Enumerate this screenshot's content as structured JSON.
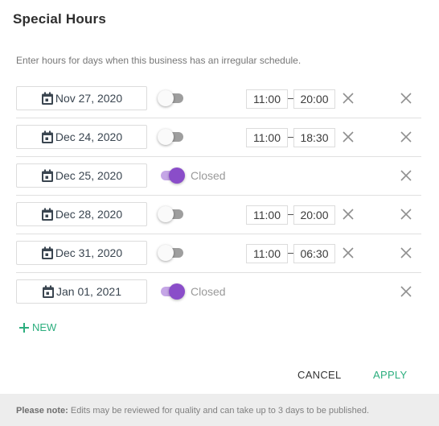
{
  "dialog": {
    "title": "Special Hours",
    "subtitle": "Enter hours for days when this business has an irregular schedule."
  },
  "colors": {
    "accent_green": "#2cae7e",
    "toggle_on_knob": "#8a4dc9",
    "toggle_on_track": "#c5a6e6",
    "toggle_off_track": "#9e9e9e"
  },
  "rows": [
    {
      "date": "Nov 27, 2020",
      "closed": false,
      "open": "11:00",
      "close": "20:00"
    },
    {
      "date": "Dec 24, 2020",
      "closed": false,
      "open": "11:00",
      "close": "18:30"
    },
    {
      "date": "Dec 25, 2020",
      "closed": true,
      "closed_label": "Closed"
    },
    {
      "date": "Dec 28, 2020",
      "closed": false,
      "open": "11:00",
      "close": "20:00"
    },
    {
      "date": "Dec 31, 2020",
      "closed": false,
      "open": "11:00",
      "close": "06:30"
    },
    {
      "date": "Jan 01, 2021",
      "closed": true,
      "closed_label": "Closed"
    }
  ],
  "icons": {
    "date": "calendar-icon",
    "clear_time": "close-icon",
    "remove_row": "close-icon",
    "add": "plus-icon"
  },
  "actions": {
    "new_label": "NEW",
    "cancel_label": "CANCEL",
    "apply_label": "APPLY"
  },
  "footer": {
    "note_label": "Please note:",
    "note_text": " Edits may be reviewed for quality and can take up to 3 days to be published."
  }
}
